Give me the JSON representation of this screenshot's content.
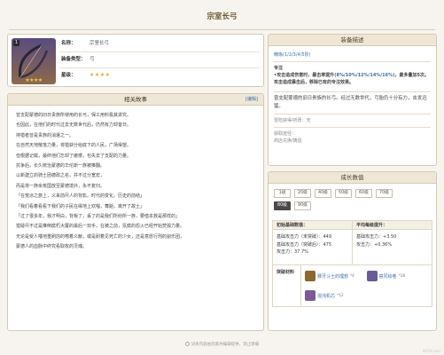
{
  "page": {
    "title": "宗室长弓"
  },
  "weapon": {
    "level_badge": "1",
    "stars": "★★★★",
    "fields": [
      {
        "label": "名称：",
        "value": "宗室长弓"
      },
      {
        "label": "装备类型：",
        "value": "弓"
      },
      {
        "label": "星级：",
        "value": "★★★★"
      }
    ]
  },
  "story": {
    "title": "相关故事",
    "edit_label": "[编辑]",
    "lines": [
      "曾支配蒙德的旧日贵族所使用的长弓，保工用料极其讲究。",
      "也因此，在他们的时代过去无数世代后，仍然有力却昔日。",
      "持猎者曾是贵族的消遣之一。",
      "在自然天地散落力量，将猎获分给底下的人民，广场得望。",
      "但根据记载，最终他们忘却了傲慢，也失去了支配的力量。",
      "抗争后，长久统治蒙德的华伦斯一族被推翻。",
      "以新建立的骑士团德政之名，并不过分宽宏，",
      "而是将一族余荒国放至蒙德境外，永不复归。",
      "「在荒凉之旅上，义来前尽人的背影。时代的变化。历史的前结」",
      "「我们看着看看下我们的子民在缘地上欢唱，舞蹈，离开了故土」",
      "「过了很多年，我才明白，背叛了，丢了的是我们所纷所一族，要借本救是那样的」",
      "猎疑尽不过是推倒腐朽大厦的最后一双手。在被之前，氛腐的怨火已经开始焚毁力量。",
      "无论是受人唾地重刷前的嗜着义献，或是耐着见死亡的少女，还是意愿行刑的刽乐团，",
      "蒙德人的血脉中终究看取枚的灵魂。"
    ]
  },
  "description": {
    "title": "装备描述",
    "refine": "精炼(1/2/3/4/5阶)",
    "effect_name": "专注",
    "effect_pre": "•攻击造成伤害时，暴击率提升",
    "effect_vals": "(8%/10%/12%/14%/16%)",
    "effect_post": "，最多叠加5次。攻击造成暴击后，移除已有的专注效果。",
    "flavor": "曾支配蒙德的旧日贵族的长弓。经过无数世代，弓胎仍十分有力，击发迅猛。",
    "obtain": "冒险获得/祈愿：无",
    "source_label": "获取途径：",
    "source_value": "商店兑换/铸造"
  },
  "stats": {
    "title": "成长数值",
    "levels": [
      "1级",
      "20级",
      "40级",
      "50级",
      "60级",
      "70级",
      "80级",
      "90级"
    ],
    "active_level": "80级",
    "col1_head": "初始基础数值：",
    "col2_head": "平均每级提升：",
    "col1_lines": [
      "基础攻击力（未突破）：449",
      "基础攻击力（突破后）：475",
      "攻击力：37.7%"
    ],
    "col2_lines": [
      "基础攻击力：+3.50",
      "攻击力：+0.36%"
    ],
    "mat_label": "突破材料",
    "materials": [
      {
        "name": "狮牙斗士的理想",
        "count": "*4"
      },
      {
        "name": "禁咒绘卷",
        "count": "*18"
      },
      {
        "name": "混沌机芯",
        "count": "*12"
      }
    ]
  },
  "footer": "词条内容由玩家共编辑提供，禁止转载",
  "watermark": "9553.com",
  "colors": {
    "accent": "#3b6ea8",
    "panel_head": "#efe7d6",
    "star": "#f2c84b"
  }
}
